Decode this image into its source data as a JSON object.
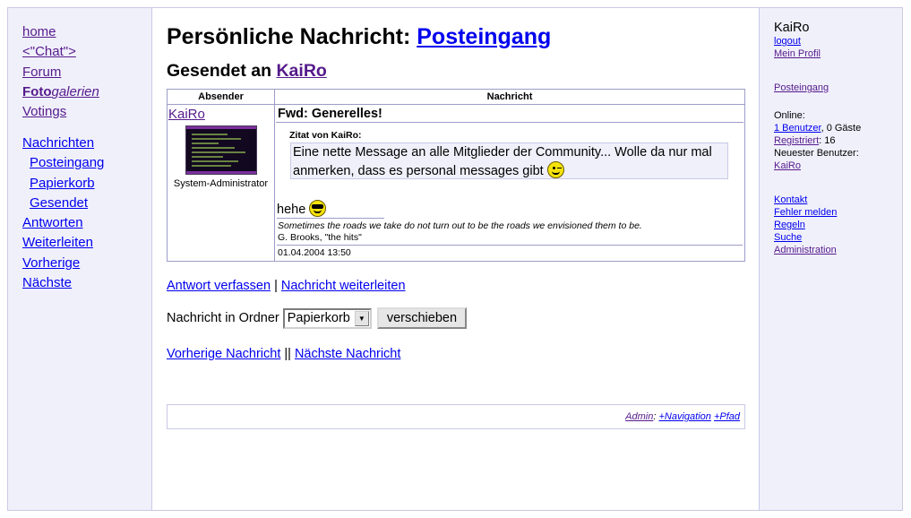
{
  "left_nav": {
    "home": "home",
    "chat": "<\"Chat\">",
    "forum": "Forum",
    "foto_bold": "Foto",
    "foto_italic": "galerien",
    "votings": "Votings",
    "nachrichten": "Nachrichten",
    "posteingang": "Posteingang",
    "papierkorb": "Papierkorb",
    "gesendet": "Gesendet",
    "antworten": "Antworten",
    "weiterleiten": "Weiterleiten",
    "vorherige": "Vorherige",
    "naechste": "Nächste"
  },
  "header": {
    "title_prefix": "Persönliche Nachricht: ",
    "title_link": "Posteingang",
    "subtitle_prefix": "Gesendet an ",
    "subtitle_link": "KaiRo"
  },
  "message_table": {
    "col_sender": "Absender",
    "col_message": "Nachricht",
    "sender_name": "KaiRo",
    "sender_role": "System-Administrator",
    "subject": "Fwd: Generelles!",
    "quote_title": "Zitat von KaiRo:",
    "quote_text": "Eine nette Message an alle Mitglieder der Community... Wolle da nur mal anmerken, dass es personal messages gibt",
    "quote_smiley": "wink-smiley-icon",
    "body_text": "hehe",
    "body_smiley": "sunglasses-smiley-icon",
    "signature_quote": "Sometimes the roads we take do not turn out to be the roads we envisioned them to be.",
    "signature_author": "G. Brooks, \"the hits\"",
    "date": "01.04.2004 13:50"
  },
  "actions": {
    "reply": "Antwort verfassen",
    "separator": " | ",
    "forward": "Nachricht weiterleiten"
  },
  "move": {
    "label": "Nachricht in Ordner",
    "selected_folder": "Papierkorb",
    "button": "verschieben"
  },
  "message_nav": {
    "previous": "Vorherige Nachricht",
    "separator": " || ",
    "next": "Nächste Nachricht"
  },
  "footer": {
    "admin": "Admin",
    "colon": ": ",
    "navigation": "+Navigation",
    "pfad": "+Pfad"
  },
  "right_sidebar": {
    "username": "KaiRo",
    "logout": "logout",
    "profile": "Mein Profil",
    "inbox": "Posteingang",
    "online_label": "Online:",
    "online_users_link": "1 Benutzer",
    "online_guests": ", 0 Gäste",
    "registered_link": "Registriert",
    "registered_count": ": 16",
    "newest_label": "Neuester Benutzer:",
    "newest_user": "KaiRo",
    "kontakt": "Kontakt",
    "fehler": "Fehler melden",
    "regeln": "Regeln",
    "suche": "Suche",
    "administration": "Administration"
  },
  "colors": {
    "sidebar_bg": "#f0f0fb",
    "border": "#9d9dc8",
    "link": "#0000ee",
    "visited_link": "#551a8b"
  }
}
